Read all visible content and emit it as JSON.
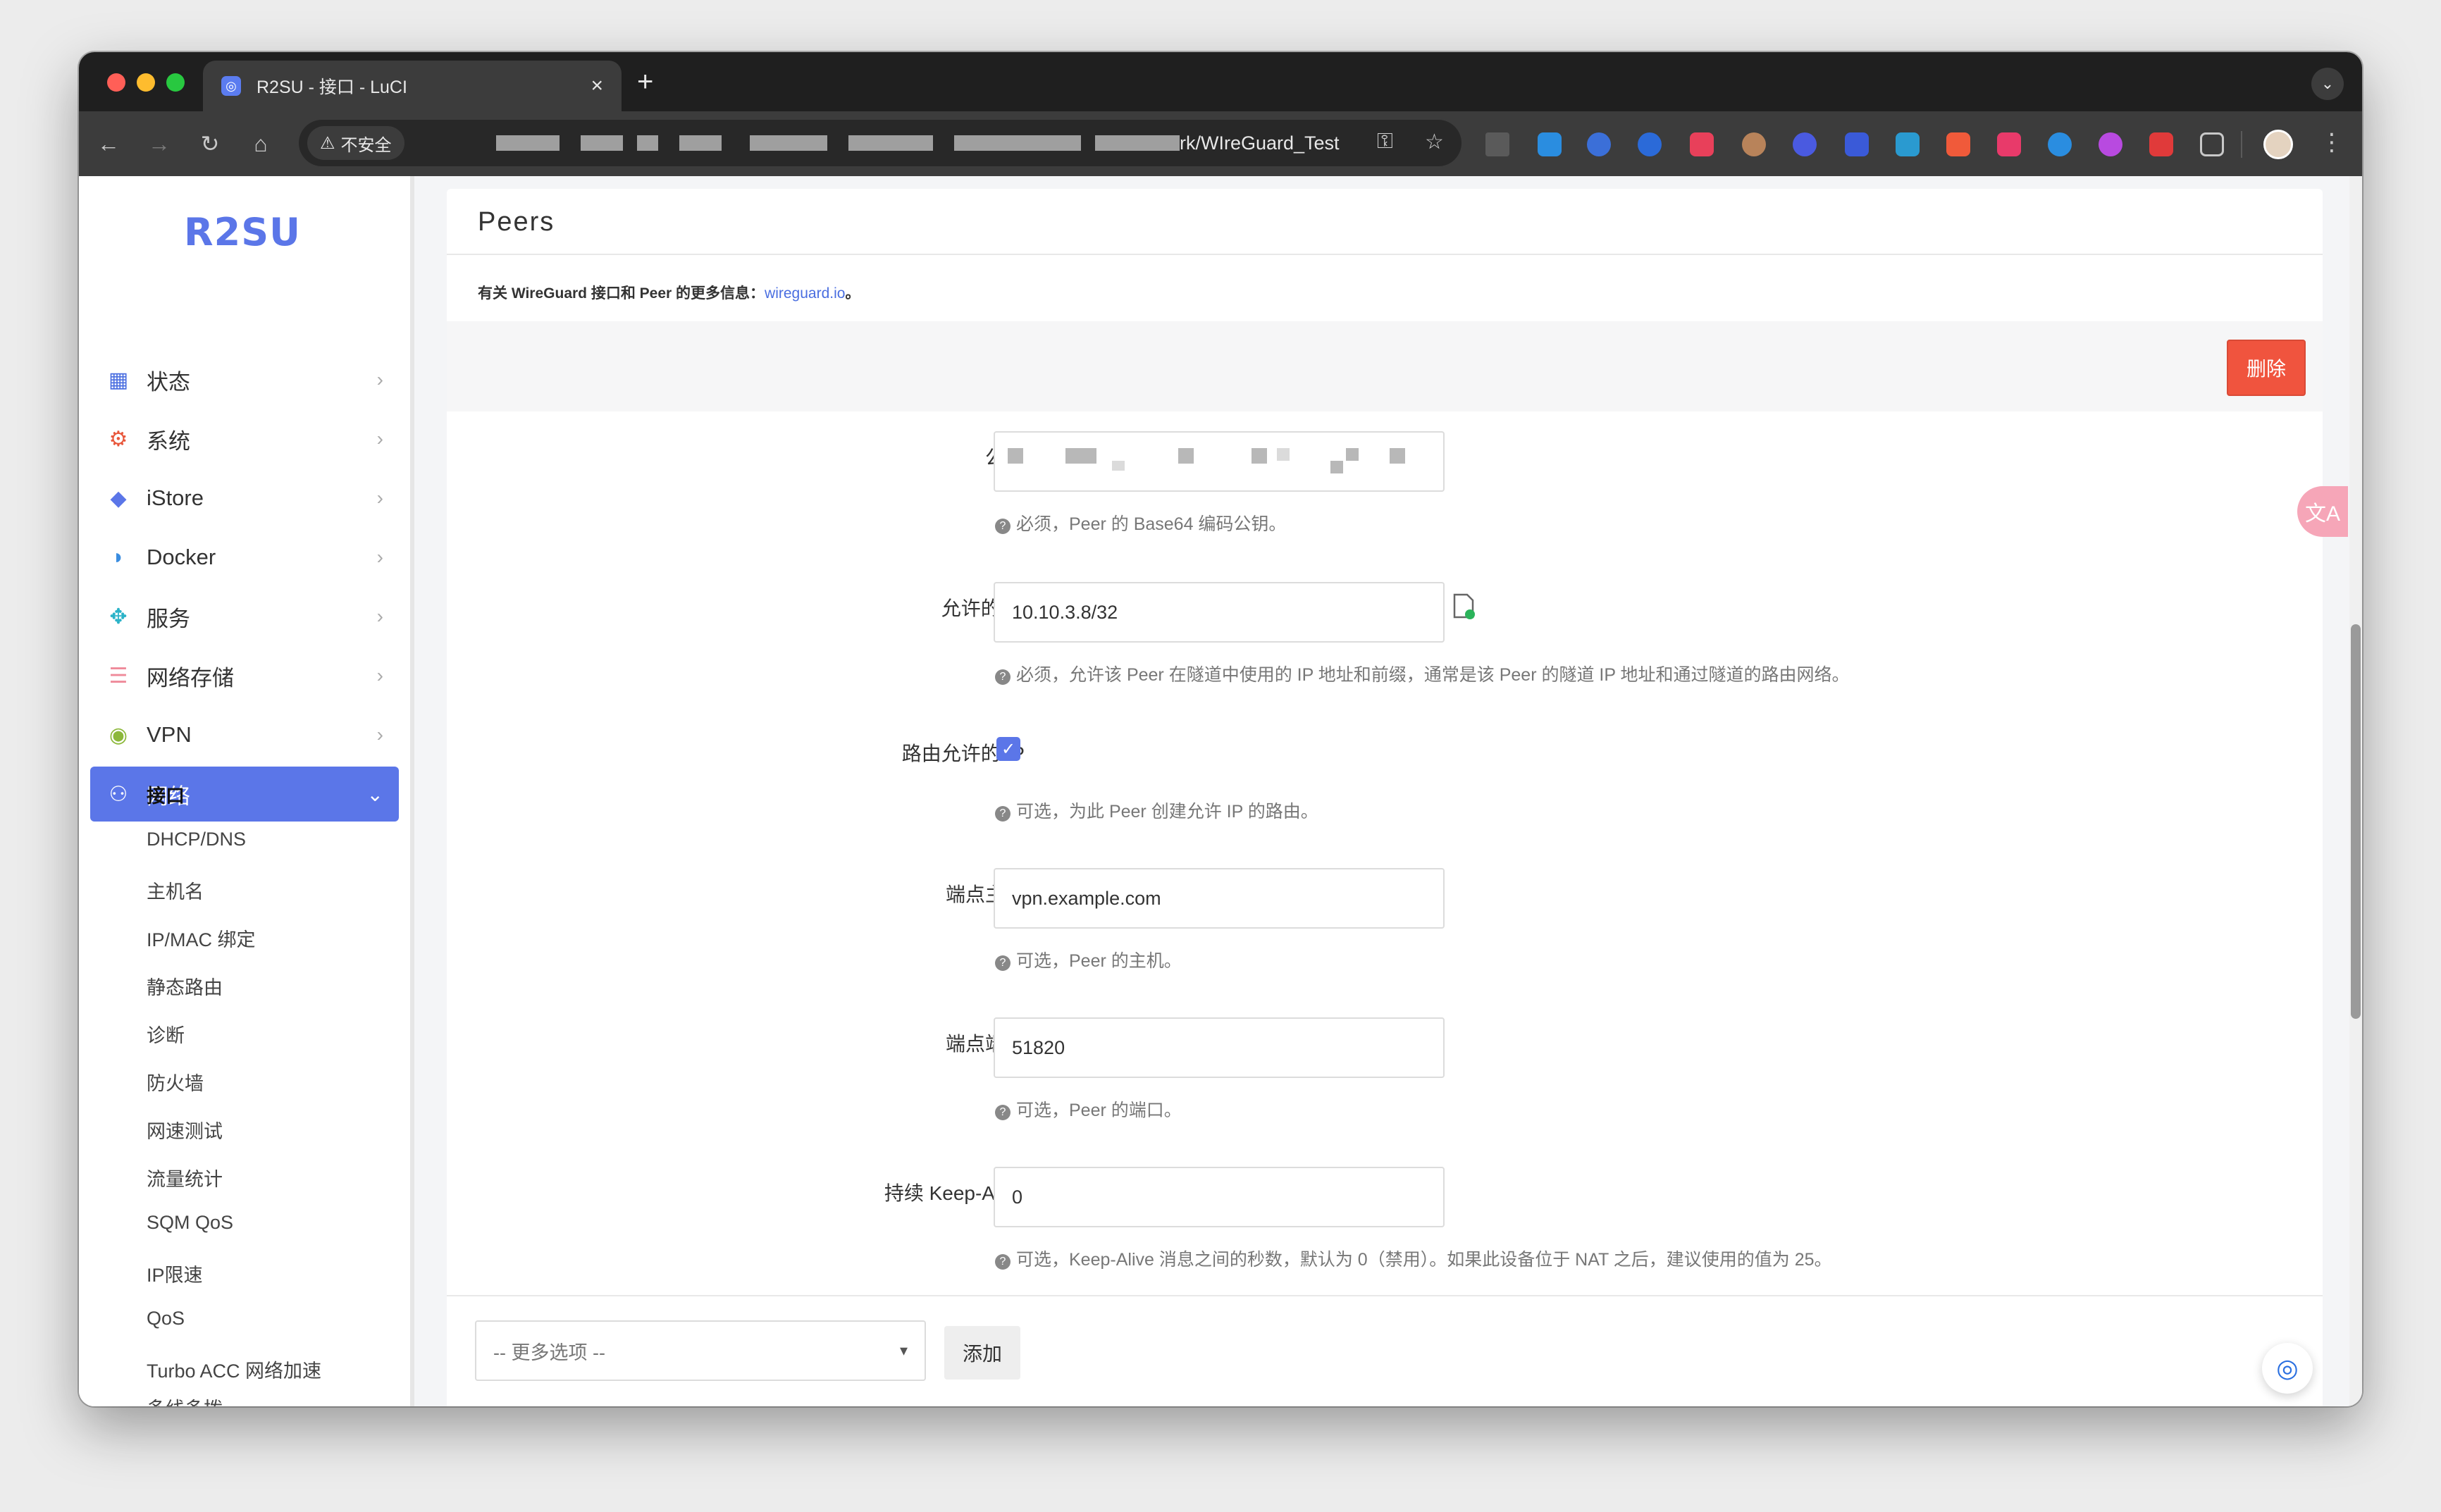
{
  "browser": {
    "tab_title": "R2SU - 接口 - LuCI",
    "tab_close": "×",
    "new_tab": "+",
    "security_label": "不安全",
    "url_visible": "rk/WIreGuard_Test"
  },
  "sidebar": {
    "logo": "R2SU",
    "menu": [
      {
        "label": "状态",
        "icon": "dashboard-icon",
        "color": "#4a6ee0"
      },
      {
        "label": "系统",
        "icon": "gear-icon",
        "color": "#e8563a"
      },
      {
        "label": "iStore",
        "icon": "cube-icon",
        "color": "#5b76e8"
      },
      {
        "label": "Docker",
        "icon": "docker-icon",
        "color": "#3a8de0"
      },
      {
        "label": "服务",
        "icon": "puzzle-icon",
        "color": "#2bb3c8"
      },
      {
        "label": "网络存储",
        "icon": "database-icon",
        "color": "#ef8a9a"
      },
      {
        "label": "VPN",
        "icon": "globe-icon",
        "color": "#8cb83a"
      },
      {
        "label": "网络",
        "icon": "network-icon",
        "color": "#ffffff"
      }
    ],
    "submenu": [
      "接口",
      "DHCP/DNS",
      "主机名",
      "IP/MAC 绑定",
      "静态路由",
      "诊断",
      "防火墙",
      "网速测试",
      "流量统计",
      "SQM QoS",
      "IP限速",
      "QoS",
      "Turbo ACC 网络加速",
      "多线多拨"
    ]
  },
  "main": {
    "section_title": "Peers",
    "info_prefix": "有关 WireGuard 接口和 Peer 的更多信息：",
    "info_link": "wireguard.io",
    "info_suffix": "。",
    "delete_label": "删除",
    "fields": {
      "public_key": {
        "label": "公钥",
        "help": "必须，Peer 的 Base64 编码公钥。"
      },
      "allowed_ips": {
        "label": "允许的 IP",
        "value": "10.10.3.8/32",
        "help": "必须，允许该 Peer 在隧道中使用的 IP 地址和前缀，通常是该 Peer 的隧道 IP 地址和通过隧道的路由网络。"
      },
      "route_allowed_ips": {
        "label": "路由允许的 IP",
        "checked": true,
        "help": "可选，为此 Peer 创建允许 IP 的路由。"
      },
      "endpoint_host": {
        "label": "端点主机",
        "value": "vpn.example.com",
        "help": "可选，Peer 的主机。"
      },
      "endpoint_port": {
        "label": "端点端口",
        "value": "51820",
        "help": "可选，Peer 的端口。"
      },
      "keepalive": {
        "label": "持续 Keep-Alive",
        "value": "0",
        "help": "可选，Keep-Alive 消息之间的秒数，默认为 0（禁用）。如果此设备位于 NAT 之后，建议使用的值为 25。"
      }
    },
    "more_options_placeholder": "-- 更多选项 --",
    "add_label": "添加"
  }
}
